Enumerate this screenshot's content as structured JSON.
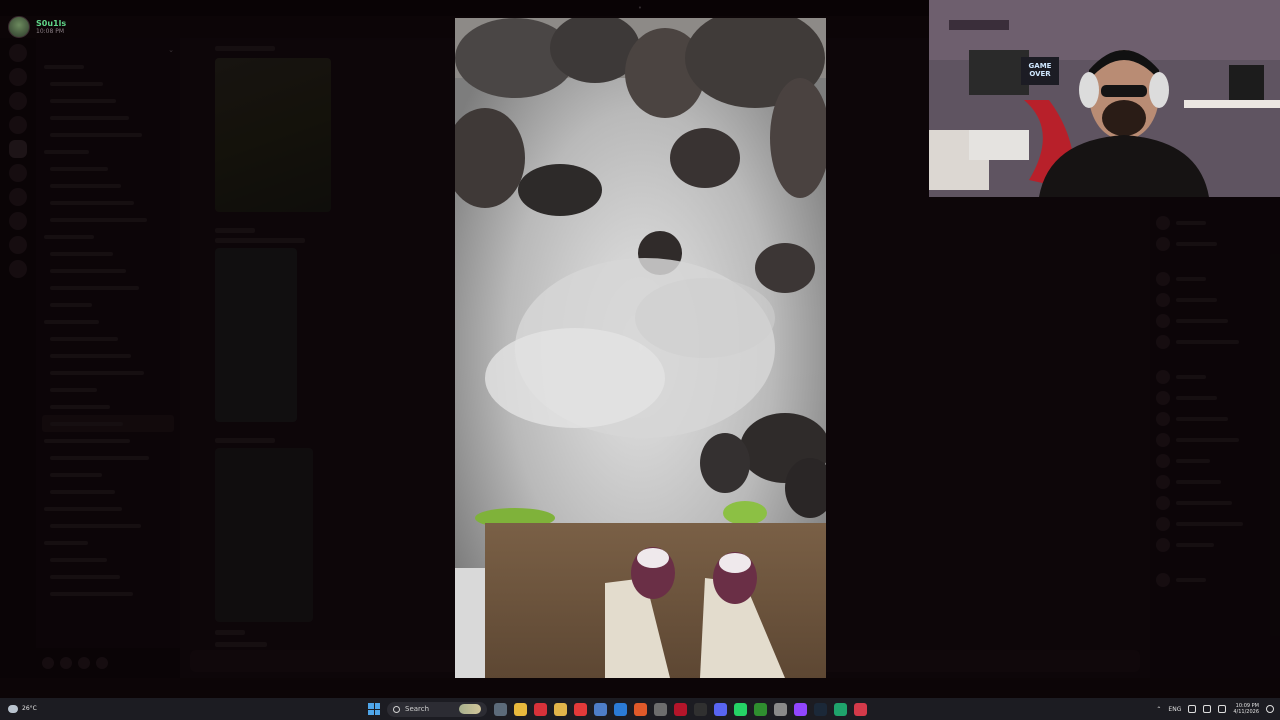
{
  "window": {
    "title": "•"
  },
  "user": {
    "name": "S0u1ls",
    "time": "10:08 PM"
  },
  "sidebar": {
    "server_title": "",
    "channels": [
      {
        "label": "",
        "kind": "cat"
      },
      {
        "label": "",
        "kind": "ch"
      },
      {
        "label": "",
        "kind": "ch"
      },
      {
        "label": "",
        "kind": "ch"
      },
      {
        "label": "",
        "kind": "ch"
      },
      {
        "label": "",
        "kind": "cat"
      },
      {
        "label": "",
        "kind": "ch"
      },
      {
        "label": "",
        "kind": "ch"
      },
      {
        "label": "",
        "kind": "ch"
      },
      {
        "label": "",
        "kind": "ch"
      },
      {
        "label": "",
        "kind": "cat"
      },
      {
        "label": "",
        "kind": "ch"
      },
      {
        "label": "",
        "kind": "ch"
      },
      {
        "label": "",
        "kind": "ch"
      },
      {
        "label": "",
        "kind": "ch"
      },
      {
        "label": "",
        "kind": "cat"
      },
      {
        "label": "",
        "kind": "ch"
      },
      {
        "label": "",
        "kind": "ch"
      },
      {
        "label": "",
        "kind": "ch"
      },
      {
        "label": "",
        "kind": "ch"
      },
      {
        "label": "",
        "kind": "ch"
      },
      {
        "label": "",
        "kind": "ch",
        "active": true
      },
      {
        "label": "",
        "kind": "cat"
      },
      {
        "label": "",
        "kind": "ch"
      },
      {
        "label": "",
        "kind": "ch"
      },
      {
        "label": "",
        "kind": "ch"
      },
      {
        "label": "",
        "kind": "cat"
      },
      {
        "label": "",
        "kind": "ch"
      },
      {
        "label": "",
        "kind": "cat"
      },
      {
        "label": "",
        "kind": "ch"
      },
      {
        "label": "",
        "kind": "ch"
      },
      {
        "label": "",
        "kind": "ch"
      }
    ],
    "voice_status": "",
    "voice_sub": ""
  },
  "chat": {
    "input_placeholder": ""
  },
  "members": {
    "groups": [
      {
        "label": "",
        "count": 2
      },
      {
        "label": "",
        "count": 4
      },
      {
        "label": "",
        "count": 9
      },
      {
        "label": "",
        "count": 1
      }
    ]
  },
  "viewer": {
    "image": "media-photo-feet-over-foggy-rocks"
  },
  "webcam": {
    "poster": "GAME OVER"
  },
  "taskbar": {
    "weather_temp": "26°C",
    "weather_sub": "",
    "search_label": "Search",
    "tray_lang": "ENG",
    "clock_time": "10:09 PM",
    "clock_date": "4/11/2026",
    "apps": [
      {
        "name": "file-explorer-icon",
        "color": "#5c6b7a"
      },
      {
        "name": "chrome-icon",
        "color": "#e8b93d"
      },
      {
        "name": "opera-icon",
        "color": "#d8323a"
      },
      {
        "name": "folder-icon",
        "color": "#e2b54a"
      },
      {
        "name": "youtube-icon",
        "color": "#e33a3a"
      },
      {
        "name": "store-icon",
        "color": "#4e7ec8"
      },
      {
        "name": "outlook-icon",
        "color": "#2b7bd6"
      },
      {
        "name": "brave-icon",
        "color": "#e05a2a"
      },
      {
        "name": "app-icon",
        "color": "#6d6d6d"
      },
      {
        "name": "app-red-icon",
        "color": "#b4152a"
      },
      {
        "name": "terminal-icon",
        "color": "#303030"
      },
      {
        "name": "discord-icon",
        "color": "#5865f2"
      },
      {
        "name": "whatsapp-icon",
        "color": "#25d366"
      },
      {
        "name": "xbox-icon",
        "color": "#2f8e2f"
      },
      {
        "name": "settings-icon",
        "color": "#8a8a8a"
      },
      {
        "name": "twitch-icon",
        "color": "#9146ff"
      },
      {
        "name": "steam-icon",
        "color": "#1b2838"
      },
      {
        "name": "green-app-icon",
        "color": "#1fa36b"
      },
      {
        "name": "opera-gx-icon",
        "color": "#d43a4a"
      }
    ]
  },
  "colors": {
    "accent_green": "#61d78a",
    "background": "#140a0d"
  }
}
